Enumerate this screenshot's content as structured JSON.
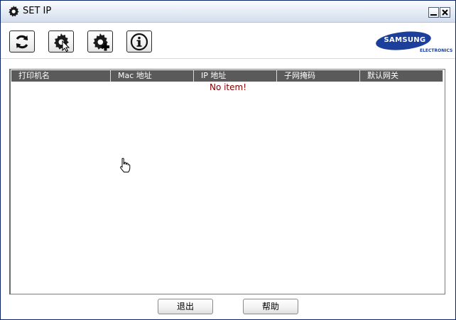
{
  "window": {
    "title": "SET IP"
  },
  "toolbar": {
    "buttons": [
      {
        "name": "refresh",
        "icon": "refresh-icon"
      },
      {
        "name": "set-ip",
        "icon": "gear-cursor-icon"
      },
      {
        "name": "add",
        "icon": "gear-plus-icon"
      },
      {
        "name": "info",
        "icon": "info-icon"
      }
    ]
  },
  "logo": {
    "brand": "SAMSUNG",
    "sub": "ELECTRONICS",
    "color": "#1b3f9a"
  },
  "list": {
    "columns": [
      "打印机名",
      "Mac 地址",
      "IP 地址",
      "子网掩码",
      "默认网关"
    ],
    "empty_message": "No item!",
    "empty_color": "#800000",
    "header_color": "#5a5a5a"
  },
  "footer": {
    "exit_label": "退出",
    "help_label": "帮助"
  }
}
